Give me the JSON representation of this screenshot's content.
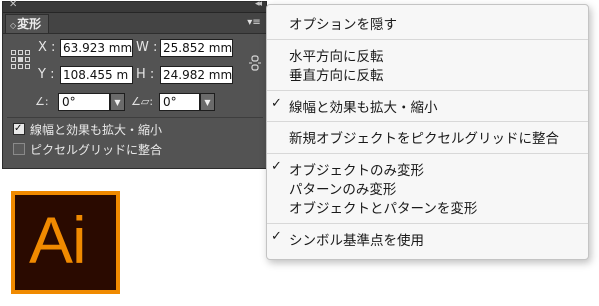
{
  "panel": {
    "tab_label": "変形",
    "tab_arrows": "◇",
    "close_glyph": "✕",
    "collapse_glyph": "◂◂",
    "menu_glyph": "▾≡",
    "x_label": "X :",
    "x_value": "63.923 mm",
    "w_label": "W :",
    "w_value": "25.852 mm",
    "y_label": "Y :",
    "y_value": "108.455 m",
    "h_label": "H :",
    "h_value": "24.982 mm",
    "rotate_icon": "∠:",
    "rotate_value": "0°",
    "shear_icon": "∠▱:",
    "shear_value": "0°",
    "checkbox_scale_label": "線幅と効果も拡大・縮小",
    "checkbox_scale_checked": true,
    "checkbox_pixel_label": "ピクセルグリッドに整合",
    "checkbox_pixel_checked": false
  },
  "menu": {
    "items": [
      {
        "label": "オプションを隠す",
        "checked": false
      },
      {
        "label": "水平方向に反転",
        "checked": false
      },
      {
        "label": "垂直方向に反転",
        "checked": false
      },
      {
        "label": "線幅と効果も拡大・縮小",
        "checked": true
      },
      {
        "label": "新規オブジェクトをピクセルグリッドに整合",
        "checked": false
      },
      {
        "label": "オブジェクトのみ変形",
        "checked": true
      },
      {
        "label": "パターンのみ変形",
        "checked": false
      },
      {
        "label": "オブジェクトとパターンを変形",
        "checked": false
      },
      {
        "label": "シンボル基準点を使用",
        "checked": true
      }
    ],
    "check_glyph": "✓"
  },
  "logo": {
    "text": "Ai",
    "colors": {
      "background": "#2a0a00",
      "accent": "#f08a00"
    }
  }
}
